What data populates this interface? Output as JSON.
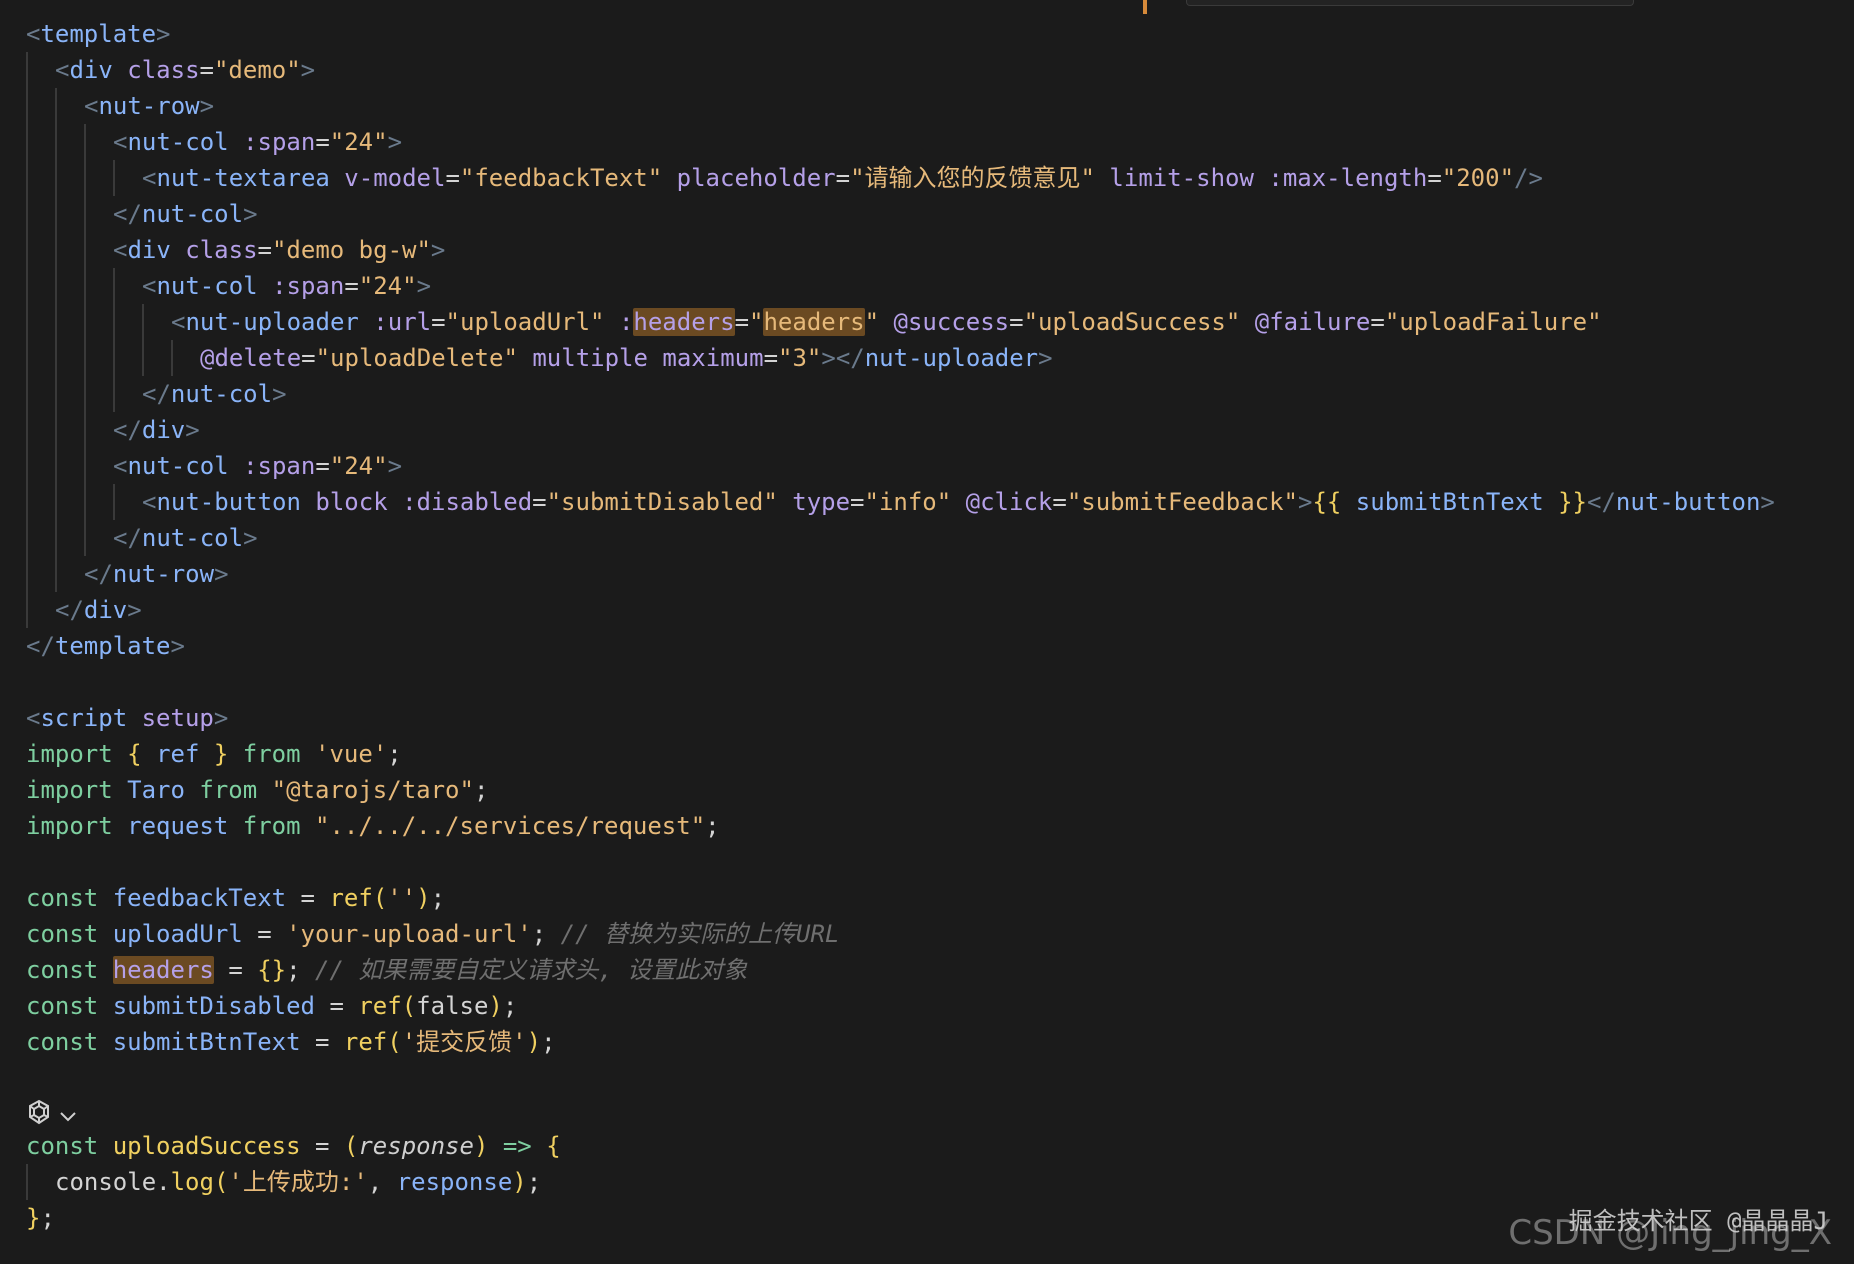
{
  "code": {
    "t_open": "template",
    "div_demo": "div",
    "class_attr": "class",
    "demo_val": "\"demo\"",
    "nut_row": "nut-row",
    "nut_col": "nut-col",
    "span_attr": ":span",
    "span_val": "\"24\"",
    "nut_textarea": "nut-textarea",
    "vmodel_attr": "v-model",
    "vmodel_val": "\"feedbackText\"",
    "placeholder_attr": "placeholder",
    "placeholder_val": "\"请输入您的反馈意见\"",
    "limit_show": "limit-show",
    "maxlen_attr": ":max-length",
    "maxlen_val": "\"200\"",
    "demo_bgw_val": "\"demo bg-w\"",
    "nut_uploader": "nut-uploader",
    "url_attr": ":url",
    "url_val": "\"uploadUrl\"",
    "headers_attr": "headers",
    "headers_val": "headers",
    "success_attr": "@success",
    "success_val": "\"uploadSuccess\"",
    "failure_attr": "@failure",
    "failure_val": "\"uploadFailure\"",
    "delete_attr": "@delete",
    "delete_val": "\"uploadDelete\"",
    "multiple": "multiple",
    "maximum_attr": "maximum",
    "maximum_val": "\"3\"",
    "nut_button": "nut-button",
    "block": "block",
    "disabled_attr": ":disabled",
    "disabled_val": "\"submitDisabled\"",
    "type_attr": "type",
    "type_val": "\"info\"",
    "click_attr": "@click",
    "click_val": "\"submitFeedback\"",
    "mustache_open": "{{",
    "mustache_var": " submitBtnText ",
    "mustache_close": "}}",
    "script_tag": "script",
    "setup": "setup",
    "import_kw": "import",
    "from_kw": "from",
    "ref": "ref",
    "vue_str": "'vue'",
    "taro": "Taro",
    "taro_str": "\"@tarojs/taro\"",
    "request": "request",
    "request_str": "\"../../../services/request\"",
    "const_kw": "const",
    "feedbackText": "feedbackText",
    "empty_str": "''",
    "uploadUrl": "uploadUrl",
    "upload_url_str": "'your-upload-url'",
    "comment1": "// 替换为实际的上传URL",
    "headers": "headers",
    "comment2": "// 如果需要自定义请求头, 设置此对象",
    "submitDisabled": "submitDisabled",
    "false_kw": "false",
    "submitBtnText": "submitBtnText",
    "submit_str": "'提交反馈'",
    "uploadSuccess": "uploadSuccess",
    "response": "response",
    "console": "console",
    "log": "log",
    "success_str": "'上传成功:'"
  },
  "watermark": {
    "line1": "掘金技术社区 @晶晶晶J",
    "line2": "CSDN @Jing_jing_X"
  },
  "icons": {
    "codelens": "ai-sparkle-icon",
    "chevron": "chevron-down-icon"
  },
  "colors": {
    "background": "#1b1b1b",
    "highlight": "#6b4a22",
    "accent": "#d68a3a"
  }
}
